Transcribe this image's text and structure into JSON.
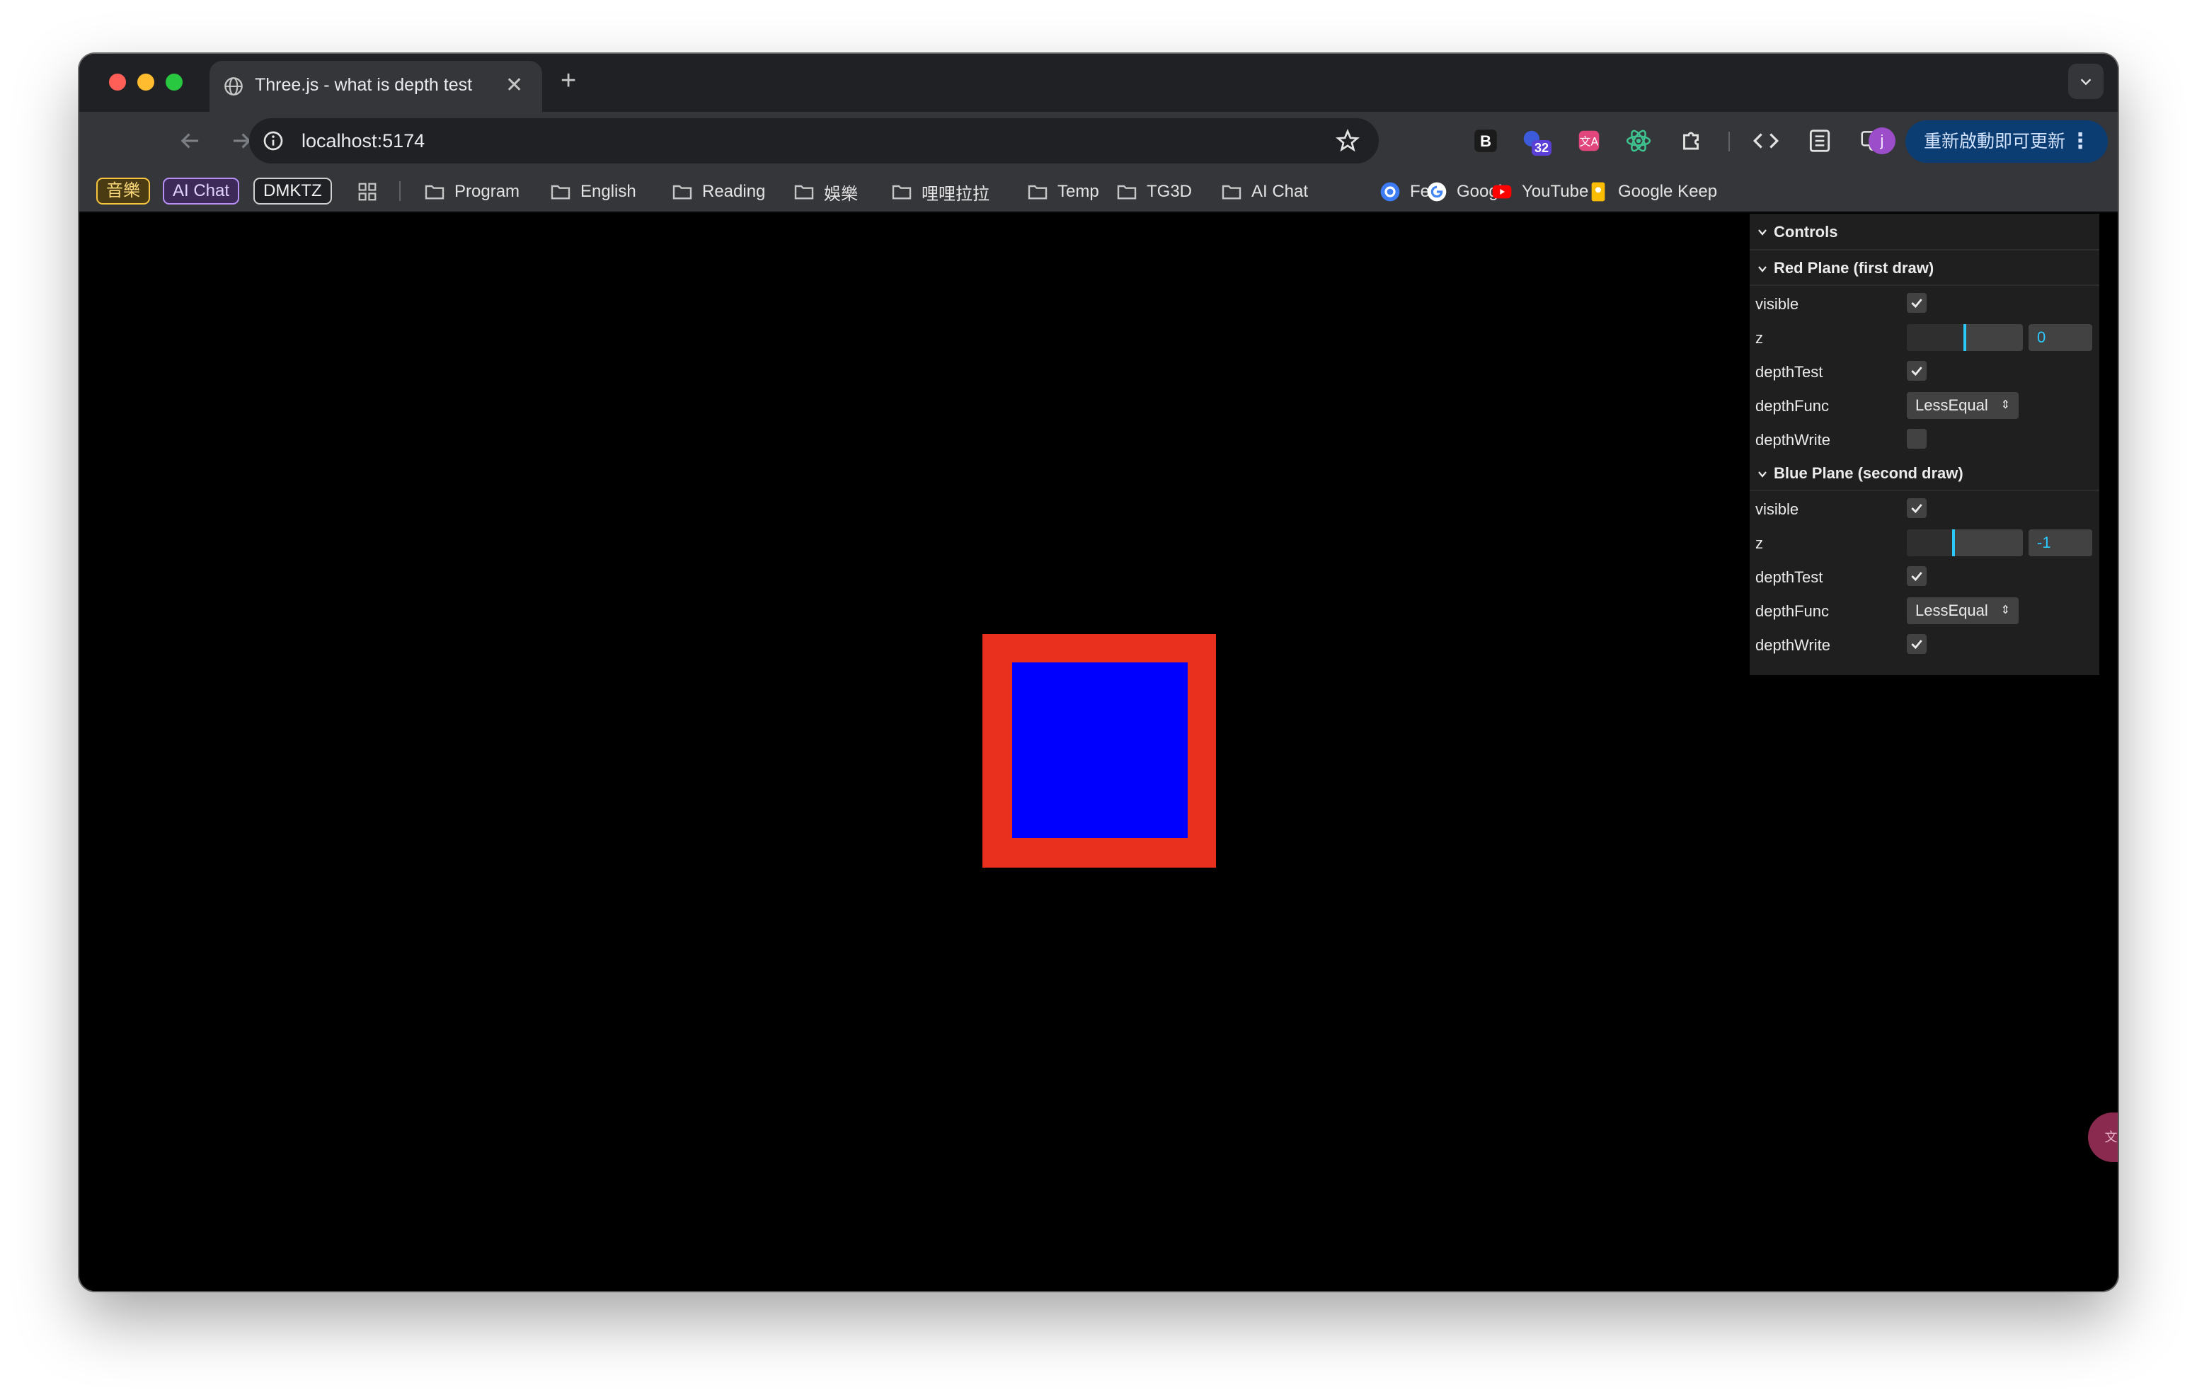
{
  "browser": {
    "tab_title": "Three.js - what is depth test",
    "tab_close": "✕",
    "new_tab": "+",
    "url": "localhost:5174",
    "extension_badge": "32",
    "profile_initial": "j",
    "update_button": "重新啟動即可更新"
  },
  "bookmarks": {
    "chips": [
      "音樂",
      "AI Chat",
      "DMKTZ"
    ],
    "items": [
      {
        "label": "Program",
        "icon": "folder-icon"
      },
      {
        "label": "English",
        "icon": "folder-icon"
      },
      {
        "label": "Reading",
        "icon": "folder-icon"
      },
      {
        "label": "娛樂",
        "icon": "folder-icon"
      },
      {
        "label": "哩哩拉拉",
        "icon": "folder-icon"
      },
      {
        "label": "Temp",
        "icon": "folder-icon"
      },
      {
        "label": "TG3D",
        "icon": "folder-icon"
      },
      {
        "label": "AI Chat",
        "icon": "folder-icon"
      },
      {
        "label": "Felo",
        "icon": "felo-icon"
      },
      {
        "label": "Google",
        "icon": "google-icon"
      },
      {
        "label": "YouTube",
        "icon": "youtube-icon"
      },
      {
        "label": "Google Keep",
        "icon": "keep-icon"
      }
    ]
  },
  "scene": {
    "red_plane_color": "#e9301f",
    "blue_plane_color": "#0000ff",
    "background": "#000000"
  },
  "gui": {
    "title": "Controls",
    "folders": [
      {
        "title": "Red Plane (first draw)",
        "visible_label": "visible",
        "visible": true,
        "z_label": "z",
        "z": "0",
        "z_fraction": 0.5,
        "depthTest_label": "depthTest",
        "depthTest": true,
        "depthFunc_label": "depthFunc",
        "depthFunc": "LessEqual",
        "depthWrite_label": "depthWrite",
        "depthWrite": false
      },
      {
        "title": "Blue Plane (second draw)",
        "visible_label": "visible",
        "visible": true,
        "z_label": "z",
        "z": "-1",
        "z_fraction": 0.4,
        "depthTest_label": "depthTest",
        "depthTest": true,
        "depthFunc_label": "depthFunc",
        "depthFunc": "LessEqual",
        "depthWrite_label": "depthWrite",
        "depthWrite": true
      }
    ]
  }
}
